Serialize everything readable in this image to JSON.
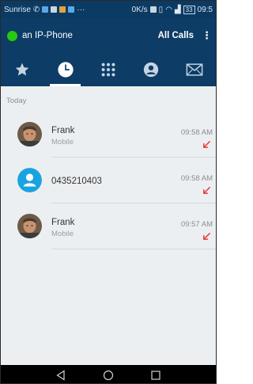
{
  "statusbar": {
    "carrier": "Sunrise",
    "net_speed": "0K/s",
    "battery": "33",
    "time": "09:5"
  },
  "appbar": {
    "title": "an IP-Phone",
    "filter_label": "All Calls",
    "more_label": "⋮",
    "status_color": "#28c90f"
  },
  "tabs": [
    {
      "icon": "star-icon",
      "active": false
    },
    {
      "icon": "clock-icon",
      "active": true
    },
    {
      "icon": "dialpad-icon",
      "active": false
    },
    {
      "icon": "contact-icon",
      "active": false
    },
    {
      "icon": "mail-icon",
      "active": false
    }
  ],
  "calls": {
    "section_label": "Today",
    "items": [
      {
        "name": "Frank",
        "type": "Mobile",
        "time": "09:58 AM",
        "avatar": "photo",
        "direction": "missed-incoming"
      },
      {
        "name": "0435210403",
        "type": "",
        "time": "09:58 AM",
        "avatar": "generic",
        "direction": "missed-incoming"
      },
      {
        "name": "Frank",
        "type": "Mobile",
        "time": "09:57 AM",
        "avatar": "photo",
        "direction": "missed-incoming"
      }
    ]
  },
  "colors": {
    "header_bg": "#0d3c66",
    "missed_arrow": "#e53935",
    "generic_avatar": "#1aa3e0"
  }
}
